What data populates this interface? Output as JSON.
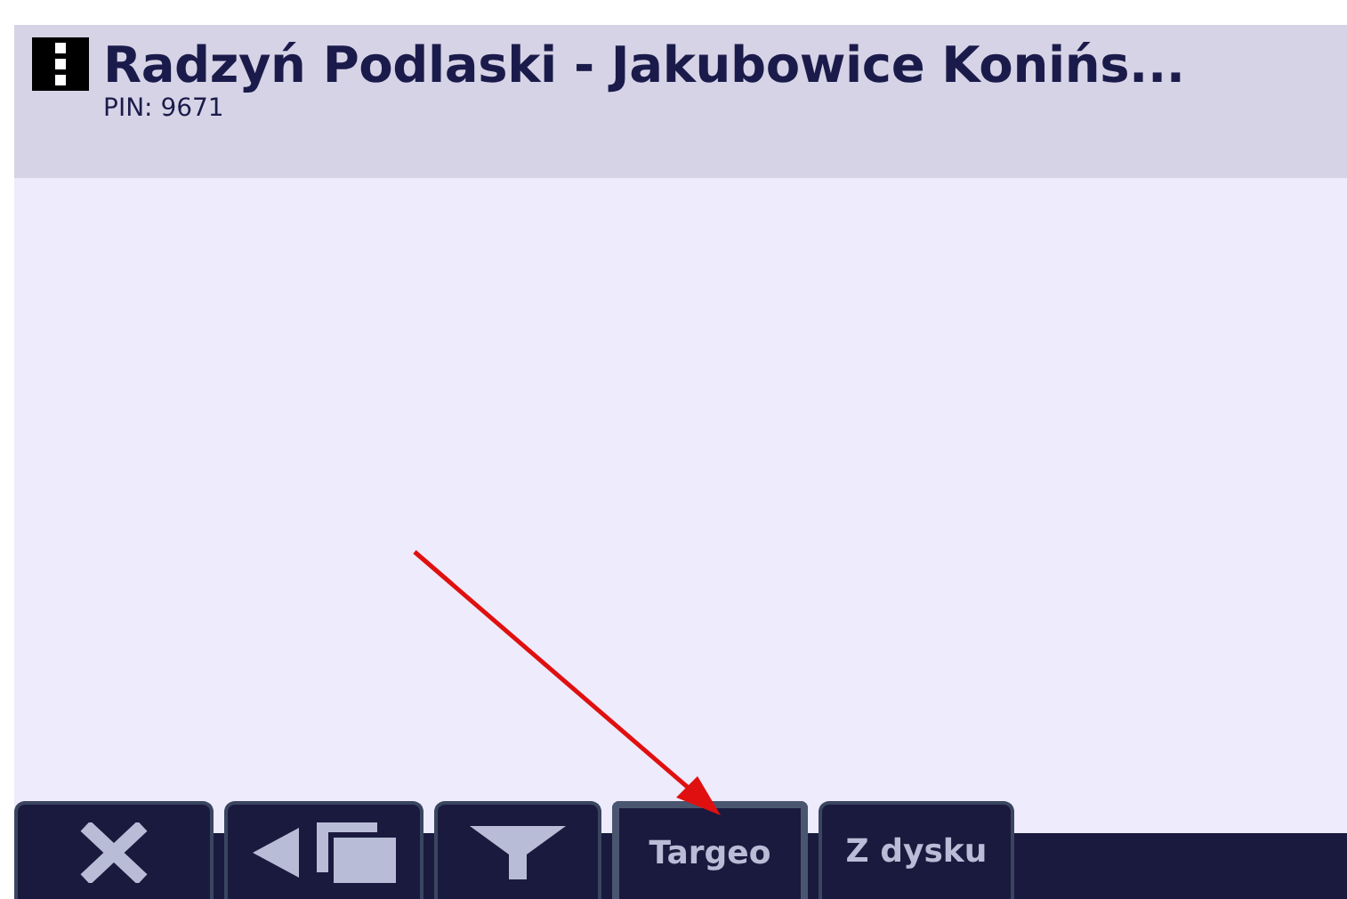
{
  "header": {
    "title": "Radzyń Podlaski - Jakubowice Konińs...",
    "subtitle": "PIN: 9671"
  },
  "toolbar": [
    {
      "kind": "close",
      "selected": false
    },
    {
      "kind": "back",
      "selected": false
    },
    {
      "kind": "filter",
      "selected": false
    },
    {
      "kind": "text",
      "label": "Targeo",
      "selected": true
    },
    {
      "kind": "text",
      "label": "Z dysku",
      "selected": false
    }
  ]
}
